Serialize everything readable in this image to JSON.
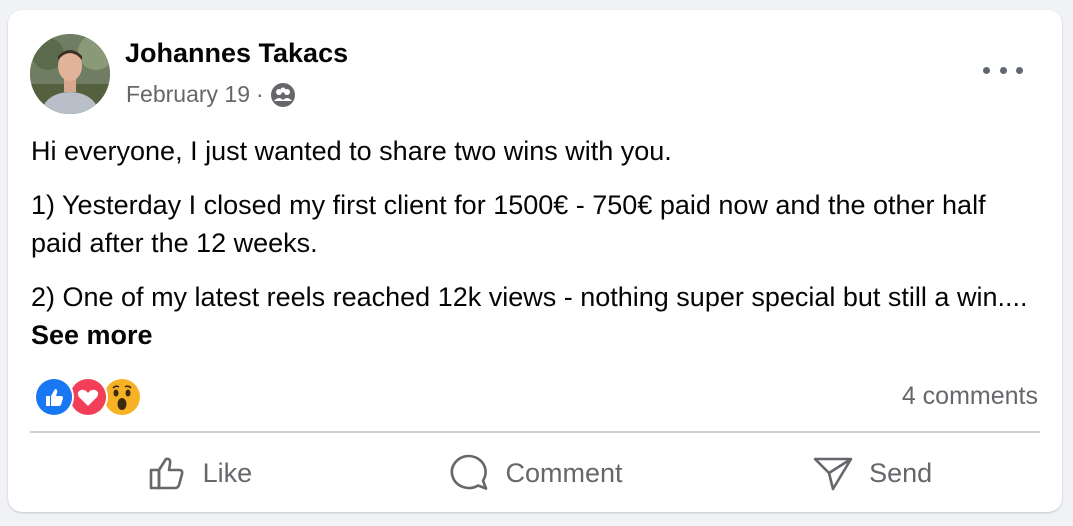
{
  "post": {
    "author": "Johannes Takacs",
    "date": "February 19",
    "separator": "·",
    "audience_icon": "friends-icon",
    "paragraphs": [
      "Hi everyone, I just wanted to share two wins with you.",
      "1) Yesterday I closed my first client for 1500€ - 750€ paid now and the other half paid after the 12 weeks.",
      "2) One of my latest reels reached 12k views - nothing super special but still a win...."
    ],
    "see_more": "See more",
    "reactions": [
      "like-icon",
      "love-icon",
      "wow-icon"
    ],
    "comments": "4 comments"
  },
  "actions": {
    "like": "Like",
    "comment": "Comment",
    "send": "Send"
  },
  "colors": {
    "like_blue": "#1877f2",
    "love_red": "#f33e58",
    "wow_yellow": "#f7b125",
    "secondary_text": "#65676b"
  }
}
